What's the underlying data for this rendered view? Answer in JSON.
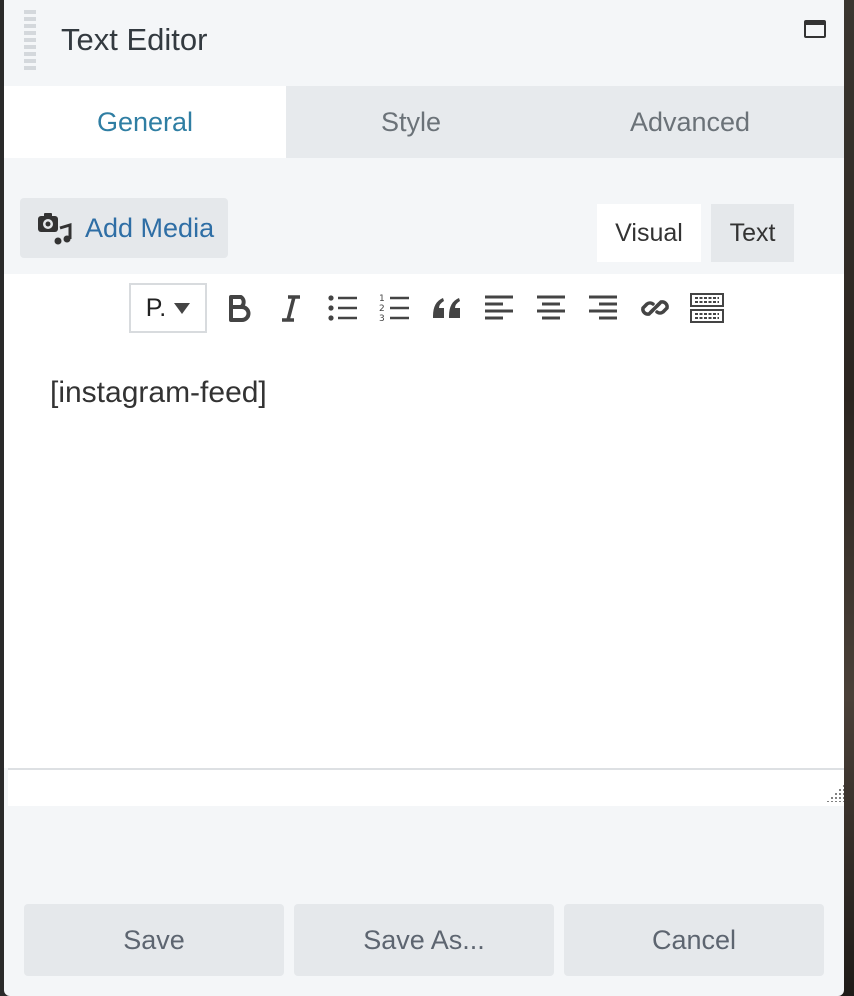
{
  "panel": {
    "title": "Text Editor"
  },
  "tabs": [
    {
      "label": "General",
      "active": true
    },
    {
      "label": "Style",
      "active": false
    },
    {
      "label": "Advanced",
      "active": false
    }
  ],
  "media": {
    "add_label": "Add Media"
  },
  "editor_modes": {
    "visual_label": "Visual",
    "text_label": "Text",
    "selected": "Visual"
  },
  "toolbar": {
    "format_value": "P.",
    "tools": [
      "bold-icon",
      "italic-icon",
      "bullet-list-icon",
      "numbered-list-icon",
      "blockquote-icon",
      "align-left-icon",
      "align-center-icon",
      "align-right-icon",
      "link-icon",
      "toolbar-toggle-icon"
    ]
  },
  "editor": {
    "content": "[instagram-feed]"
  },
  "footer": {
    "save_label": "Save",
    "save_as_label": "Save As...",
    "cancel_label": "Cancel"
  },
  "colors": {
    "active_tab_text": "#2f7ea3",
    "link_text": "#2e6ea5",
    "panel_bg": "#f4f6f8"
  }
}
